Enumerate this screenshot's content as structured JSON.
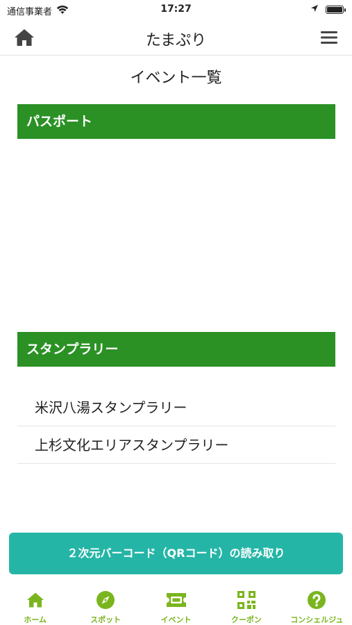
{
  "status_bar": {
    "carrier": "通信事業者",
    "time": "17:27"
  },
  "header": {
    "title": "たまぷり",
    "home_icon": "home-icon",
    "menu_icon": "hamburger-menu-icon"
  },
  "page": {
    "title": "イベント一覧"
  },
  "sections": {
    "passport": {
      "title": "パスポート"
    },
    "stamp_rally": {
      "title": "スタンプラリー",
      "items": [
        {
          "label": "米沢八湯スタンプラリー"
        },
        {
          "label": "上杉文化エリアスタンプラリー"
        }
      ]
    }
  },
  "qr_button": {
    "label": "２次元バーコード（QRコード）の読み取り"
  },
  "tab_bar": {
    "items": [
      {
        "label": "ホーム",
        "icon": "home-icon"
      },
      {
        "label": "スポット",
        "icon": "compass-icon"
      },
      {
        "label": "イベント",
        "icon": "ticket-icon"
      },
      {
        "label": "クーポン",
        "icon": "qr-code-icon"
      },
      {
        "label": "コンシェルジュ",
        "icon": "help-icon"
      }
    ]
  },
  "colors": {
    "section_header": "#2b9125",
    "qr_button": "#25b5a6",
    "tab_accent": "#7ab51d"
  }
}
